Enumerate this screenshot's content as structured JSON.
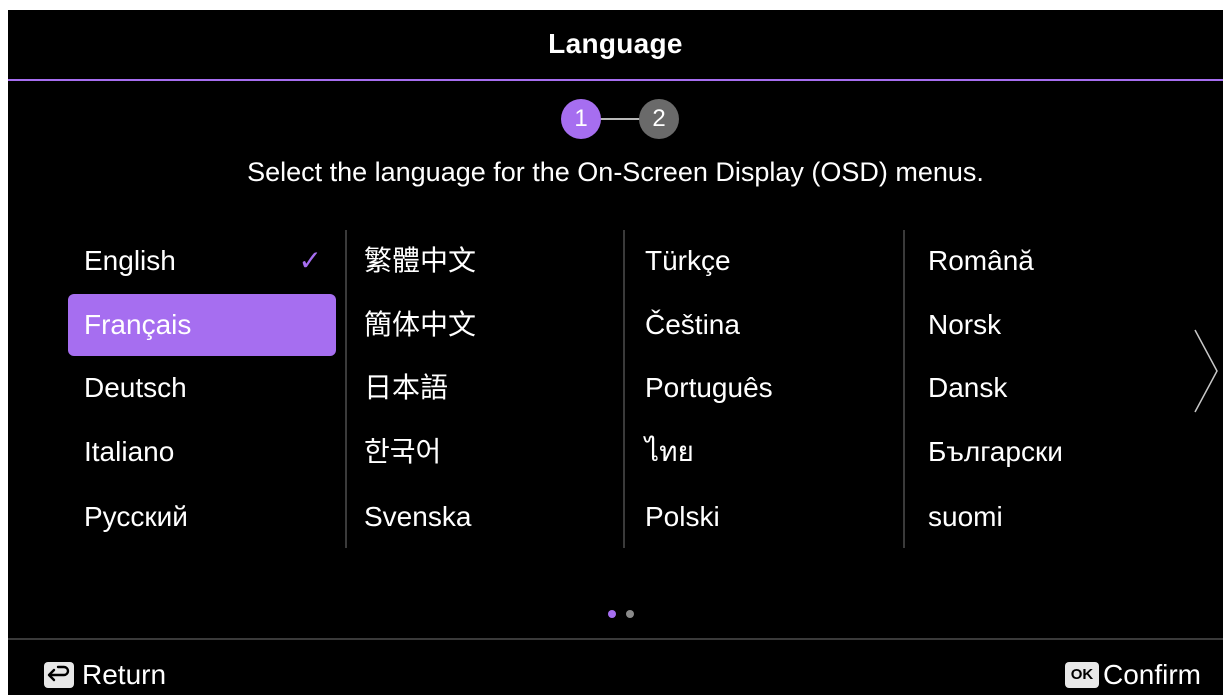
{
  "header": {
    "title": "Language"
  },
  "stepper": {
    "steps": [
      "1",
      "2"
    ],
    "active_step": 1,
    "active_color": "#a66ef0",
    "inactive_color": "#6a6a6a"
  },
  "instruction": "Select the language for the On-Screen Display (OSD) menus.",
  "languages": {
    "columns": [
      [
        "English",
        "Français",
        "Deutsch",
        "Italiano",
        "Русский"
      ],
      [
        "繁體中文",
        "簡体中文",
        "日本語",
        "한국어",
        "Svenska"
      ],
      [
        "Türkçe",
        "Čeština",
        "Português",
        "ไทย",
        "Polski"
      ],
      [
        "Română",
        "Norsk",
        "Dansk",
        "Български",
        "suomi"
      ]
    ],
    "current": "English",
    "current_mark": "✓",
    "highlighted": "Français"
  },
  "pagination": {
    "pages": 2,
    "current_page": 1
  },
  "footer": {
    "return_label": "Return",
    "confirm_label": "Confirm",
    "ok_key": "OK"
  },
  "colors": {
    "accent": "#a66ef0",
    "background": "#000000",
    "text": "#ffffff"
  }
}
